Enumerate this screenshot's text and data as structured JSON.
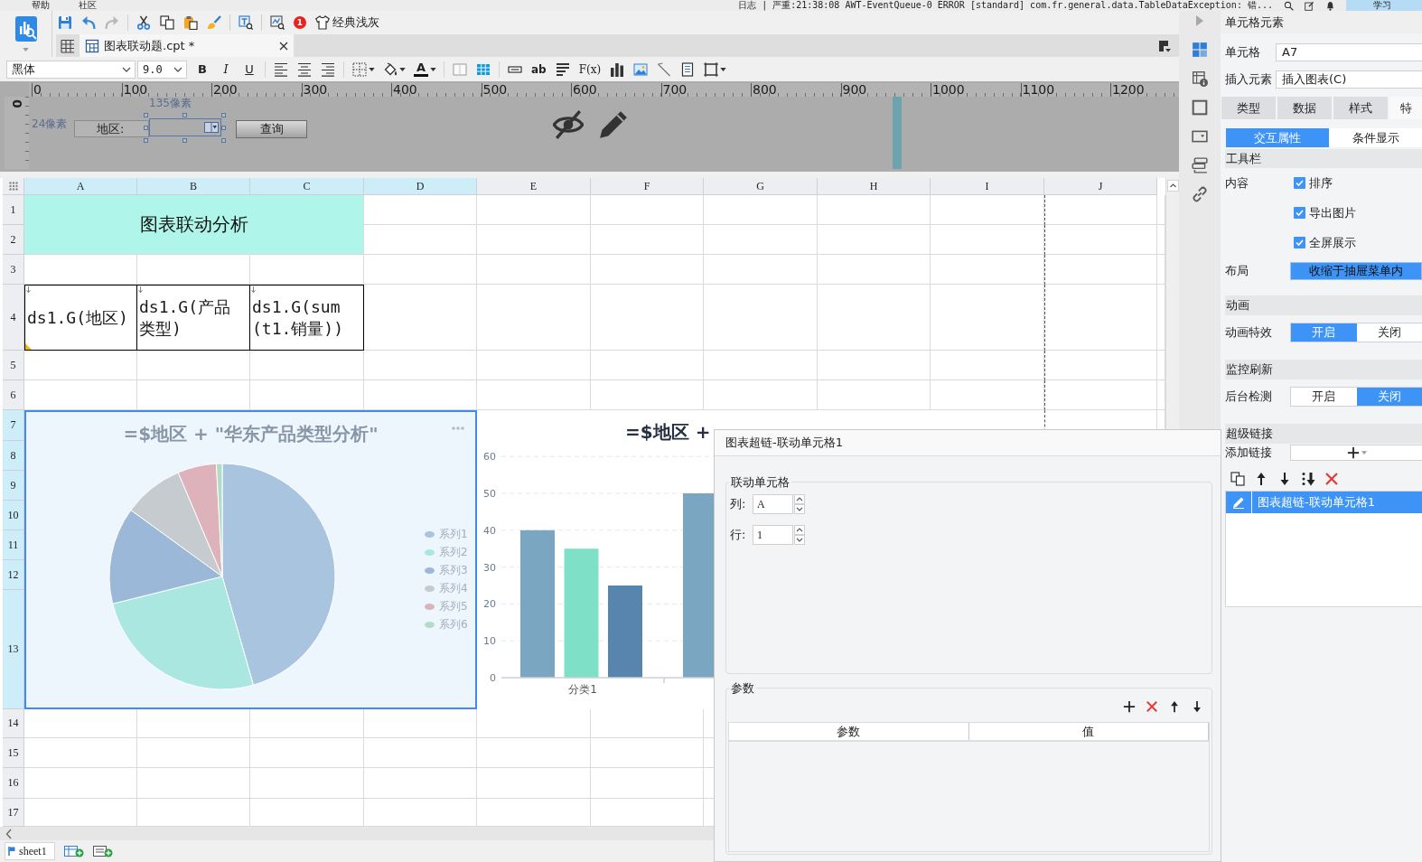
{
  "menu_bar": {
    "items": [
      "帮助",
      "社区"
    ],
    "log": "日志 | 严重:21:38:08 AWT-EventQueue-0 ERROR [standard] com.fr.general.data.TableDataException: 错...",
    "account": "学习"
  },
  "toolbar": [
    {
      "kind": "save"
    },
    {
      "kind": "undo"
    },
    {
      "kind": "redo"
    },
    {
      "kind": "sep"
    },
    {
      "kind": "cut"
    },
    {
      "kind": "copy"
    },
    {
      "kind": "paste"
    },
    {
      "kind": "brush"
    },
    {
      "kind": "sep"
    },
    {
      "kind": "text-search"
    },
    {
      "kind": "sep"
    },
    {
      "kind": "preview"
    },
    {
      "kind": "badge",
      "label": "1"
    },
    {
      "kind": "theme",
      "label": "经典浅灰"
    }
  ],
  "editor_tabs": [
    {
      "label": "图表联动题.cpt *",
      "selected": true
    }
  ],
  "format_toolbar": {
    "font": "黑体",
    "size": "9.0",
    "buttons": [
      {
        "kind": "bold",
        "label": "B"
      },
      {
        "kind": "italic",
        "label": "I"
      },
      {
        "kind": "underline",
        "label": "U"
      },
      {
        "kind": "sep"
      },
      {
        "kind": "align-left"
      },
      {
        "kind": "align-center"
      },
      {
        "kind": "align-right"
      },
      {
        "kind": "sep"
      },
      {
        "kind": "border",
        "caret": true
      },
      {
        "kind": "fill",
        "caret": true
      },
      {
        "kind": "font-color",
        "label": "A",
        "caret": true
      },
      {
        "kind": "sep"
      },
      {
        "kind": "merge"
      },
      {
        "kind": "table"
      },
      {
        "kind": "sep"
      },
      {
        "kind": "text-field"
      },
      {
        "kind": "text-wrap",
        "label": "ab"
      },
      {
        "kind": "lines"
      },
      {
        "kind": "formula",
        "label": "F(x)"
      },
      {
        "kind": "bar-chart"
      },
      {
        "kind": "image"
      },
      {
        "kind": "slash"
      },
      {
        "kind": "document"
      },
      {
        "kind": "frame",
        "caret": true
      }
    ]
  },
  "parameter_pane": {
    "ruler": [
      "0",
      "100",
      "200",
      "300",
      "400",
      "500",
      "600",
      "700",
      "800",
      "900",
      "1000",
      "1100",
      "1200"
    ],
    "side_ruler": "0",
    "width_hint": "135像素",
    "height_hint": "24像素",
    "label": "地区:",
    "button": "查询"
  },
  "sheet": {
    "columns": [
      {
        "label": "A",
        "selected": true
      },
      {
        "label": "B",
        "selected": true
      },
      {
        "label": "C",
        "selected": true
      },
      {
        "label": "D",
        "selected": true
      },
      {
        "label": "E",
        "selected": false
      },
      {
        "label": "F",
        "selected": false
      },
      {
        "label": "G",
        "selected": false
      },
      {
        "label": "H",
        "selected": false
      },
      {
        "label": "I",
        "selected": false
      },
      {
        "label": "J",
        "selected": false
      }
    ],
    "rows": [
      {
        "label": "1",
        "selected": false
      },
      {
        "label": "2",
        "selected": false
      },
      {
        "label": "3",
        "selected": false
      },
      {
        "label": "4",
        "selected": false
      },
      {
        "label": "5",
        "selected": false
      },
      {
        "label": "6",
        "selected": false
      },
      {
        "label": "7",
        "selected": true
      },
      {
        "label": "8",
        "selected": true
      },
      {
        "label": "9",
        "selected": true
      },
      {
        "label": "10",
        "selected": true
      },
      {
        "label": "11",
        "selected": true
      },
      {
        "label": "12",
        "selected": true
      },
      {
        "label": "13",
        "selected": true
      },
      {
        "label": "14",
        "selected": false
      },
      {
        "label": "15",
        "selected": false
      },
      {
        "label": "16",
        "selected": false
      },
      {
        "label": "17",
        "selected": false
      }
    ],
    "title": "图表联动分析",
    "header_cells": [
      "ds1.G(地区)",
      "ds1.G(产品类型)",
      "ds1.G(sum(t1.销量))"
    ]
  },
  "pie_chart": {
    "title": "=$地区 + \"华东产品类型分析\"",
    "selected": true,
    "legend": [
      {
        "label": "系列1",
        "color": "#a8c4de"
      },
      {
        "label": "系列2",
        "color": "#aae7e0"
      },
      {
        "label": "系列3",
        "color": "#9bb8d8"
      },
      {
        "label": "系列4",
        "color": "#c6cbd0"
      },
      {
        "label": "系列5",
        "color": "#ddb2ba"
      },
      {
        "label": "系列6",
        "color": "#b3dbca"
      }
    ]
  },
  "bar_chart": {
    "title": "=$地区 +",
    "chart_data": {
      "type": "bar",
      "categories": [
        "分类1",
        null
      ],
      "series": [
        {
          "color": "#7aa6c2",
          "values": [
            40,
            50
          ]
        },
        {
          "color": "#7ee0c6",
          "values": [
            35,
            null
          ]
        },
        {
          "color": "#5785ad",
          "values": [
            25,
            null
          ]
        }
      ],
      "ylim": [
        0,
        60
      ],
      "yticks": [
        0,
        10,
        20,
        30,
        40,
        50,
        60
      ],
      "grid": true
    }
  },
  "dialog": {
    "title": "图表超链-联动单元格1",
    "group": "联动单元格",
    "fields": [
      {
        "label": "列:",
        "value": "A"
      },
      {
        "label": "行:",
        "value": "1"
      }
    ],
    "params_group": "参数",
    "columns": [
      "参数",
      "值"
    ]
  },
  "side_tabs": [
    {
      "kind": "cell",
      "selected": true
    },
    {
      "kind": "cell-info",
      "selected": false
    },
    {
      "kind": "frame",
      "selected": false
    },
    {
      "kind": "widget",
      "selected": false
    },
    {
      "kind": "layers",
      "selected": false
    },
    {
      "kind": "link",
      "selected": false
    }
  ],
  "properties": {
    "title": "单元格元素",
    "fields": [
      {
        "label": "单元格",
        "value": "A7"
      },
      {
        "label": "插入元素",
        "value": "插入图表(C)"
      }
    ],
    "tabs": [
      {
        "label": "类型",
        "selected": false
      },
      {
        "label": "数据",
        "selected": false
      },
      {
        "label": "样式",
        "selected": false
      },
      {
        "label": "特",
        "selected": true
      }
    ],
    "subtabs": [
      {
        "label": "交互属性",
        "selected": true
      },
      {
        "label": "条件显示",
        "selected": false
      }
    ],
    "sections": [
      {
        "title": "工具栏",
        "rows": [
          {
            "kind": "checks",
            "label": "内容",
            "options": [
              {
                "label": "排序",
                "checked": true
              },
              {
                "label": "导出图片",
                "checked": true
              },
              {
                "label": "全屏展示",
                "checked": true
              }
            ]
          },
          {
            "kind": "select",
            "label": "布局",
            "value": "收缩于抽屉菜单内"
          }
        ]
      },
      {
        "title": "动画",
        "rows": [
          {
            "kind": "toggle",
            "label": "动画特效",
            "options": [
              {
                "label": "开启",
                "selected": true
              },
              {
                "label": "关闭",
                "selected": false
              }
            ]
          }
        ]
      },
      {
        "title": "监控刷新",
        "rows": [
          {
            "kind": "toggle",
            "label": "后台检测",
            "options": [
              {
                "label": "开启",
                "selected": false
              },
              {
                "label": "关闭",
                "selected": true
              }
            ]
          }
        ]
      },
      {
        "title": "超级链接",
        "rows": [
          {
            "kind": "add",
            "label": "添加链接"
          }
        ]
      }
    ],
    "links": [
      {
        "label": "图表超链-联动单元格1",
        "selected": true
      }
    ]
  },
  "sheet_tabs": [
    {
      "label": "sheet1",
      "selected": true
    }
  ]
}
